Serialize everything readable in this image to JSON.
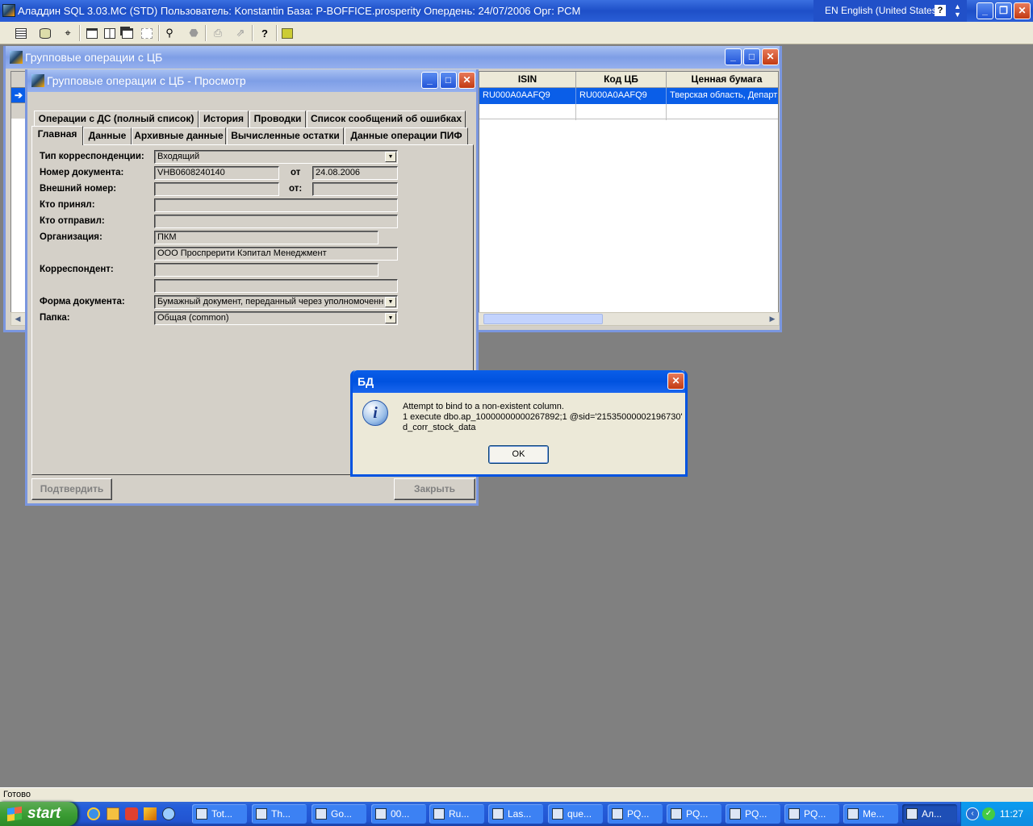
{
  "app": {
    "title": "Аладдин SQL 3.03.MC (STD)  Пользователь: Konstantin База: P-BOFFICE.prosperity Опердень: 24/07/2006 Орг: PCM",
    "lang": "EN English (United States)",
    "help": "?",
    "status": "Готово"
  },
  "win_back": {
    "title": "Групповые операции с ЦБ",
    "columns": [
      "ISIN",
      "Код ЦБ",
      "Ценная бумага"
    ],
    "rows": [
      [
        "RU000A0AAFQ9",
        "RU000A0AAFQ9",
        "Тверская область, Департ"
      ]
    ]
  },
  "win_view": {
    "title": "Групповые операции с ЦБ - Просмотр",
    "tabs_row1": [
      "Операции с ДС (полный список)",
      "История",
      "Проводки",
      "Список сообщений об ошибках"
    ],
    "tabs_row2": [
      "Главная",
      "Данные",
      "Архивные данные",
      "Вычисленные остатки",
      "Данные операции ПИФ"
    ],
    "labels": {
      "corr_type": "Тип корреспонденции:",
      "doc_num": "Номер документа:",
      "from1": "от",
      "ext_num": "Внешний номер:",
      "from2": "от:",
      "received": "Кто принял:",
      "sent": "Кто отправил:",
      "org": "Организация:",
      "correspondent": "Корреспондент:",
      "doc_form": "Форма документа:",
      "folder": "Папка:"
    },
    "values": {
      "corr_type": "Входящий",
      "doc_num": "VHB0608240140",
      "doc_date": "24.08.2006",
      "ext_num": "",
      "ext_date": "",
      "received": "",
      "sent": "",
      "org_code": "ПКМ",
      "org_name": "ООО Проспрерити Кэпитал Менеджмент",
      "corr_code": "",
      "corr_name": "",
      "doc_form": "Бумажный документ, переданный через уполномоченн",
      "folder": "Общая  (common)"
    },
    "buttons": {
      "confirm": "Подтвердить",
      "close": "Закрыть"
    }
  },
  "dialog": {
    "title": "БД",
    "line1": "Attempt to bind to a non-existent column.",
    "line2": "1 execute dbo.ap_10000000000267892;1 @sid='21535000002196730'",
    "line3": "d_corr_stock_data",
    "ok": "OK"
  },
  "taskbar": {
    "start": "start",
    "tasks": [
      "Tot...",
      "Th...",
      "Go...",
      "00...",
      "Ru...",
      "Las...",
      "que...",
      "PQ...",
      "PQ...",
      "PQ...",
      "PQ...",
      "Me...",
      "Ал..."
    ],
    "clock": "11:27"
  },
  "colors": {
    "xp_blue": "#0053e1",
    "mdi_bg": "#808080",
    "selection": "#0a5ee8"
  }
}
